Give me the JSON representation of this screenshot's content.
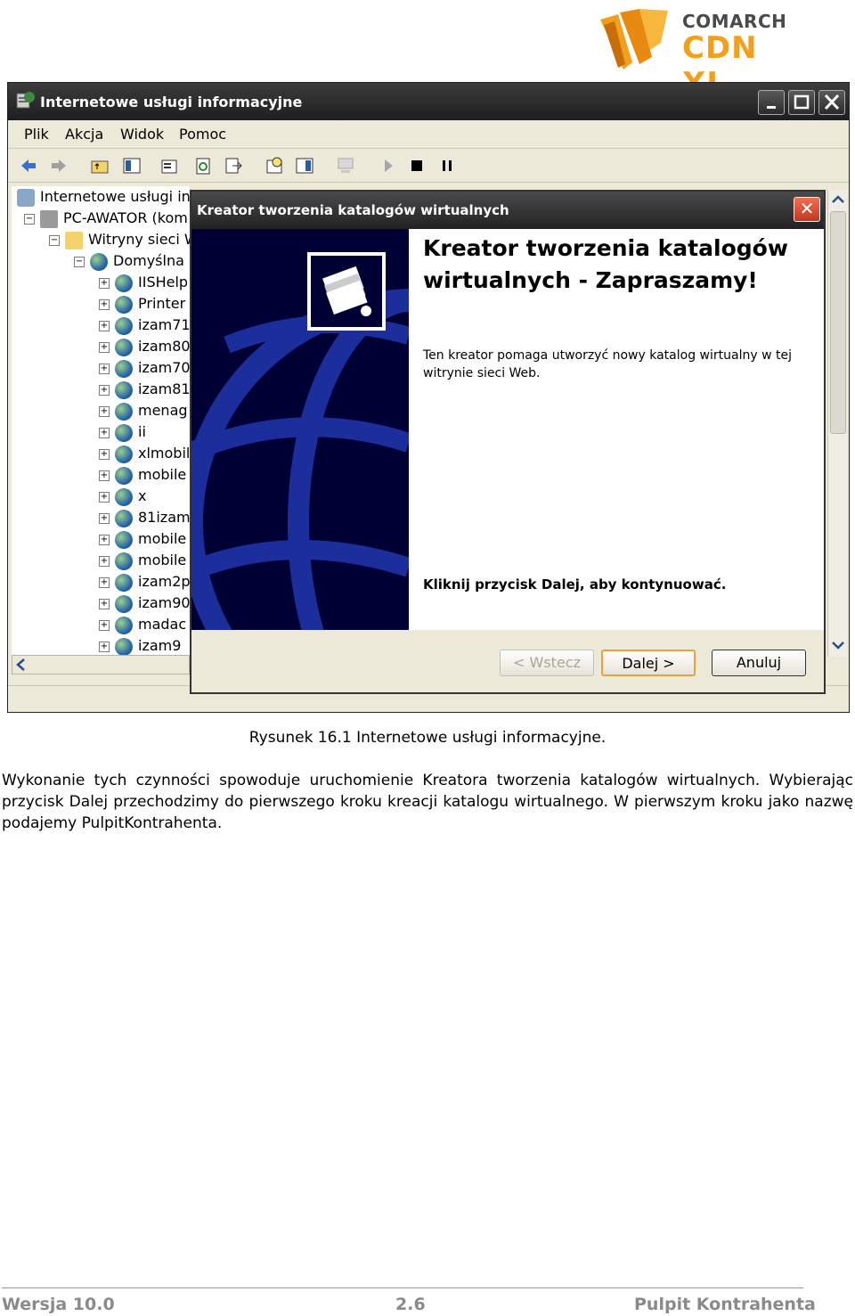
{
  "logo": {
    "line1": "COMARCH",
    "line2": "CDN XL"
  },
  "window": {
    "title": "Internetowe usługi informacyjne",
    "controls": [
      "minimize-icon",
      "maximize-icon",
      "close-icon"
    ],
    "menu": [
      "Plik",
      "Akcja",
      "Widok",
      "Pomoc"
    ],
    "toolbar_icons": [
      "back-arrow-icon",
      "forward-arrow-icon",
      "up-folder-icon",
      "show-tree-icon",
      "properties-icon",
      "refresh-icon",
      "export-icon",
      "help-icon",
      "console-icon",
      "computer-icon",
      "play-icon",
      "stop-icon",
      "pause-icon"
    ]
  },
  "tree": {
    "root": "Internetowe usługi inf",
    "computer": "PC-AWATOR (kom",
    "sites_folder": "Witryny sieci W",
    "default_site": "Domyślna",
    "children": [
      "IISHelp",
      "Printer",
      "izam71",
      "izam80",
      "izam70",
      "izam81",
      "menag",
      "ii",
      "xlmobil",
      "mobile",
      "x",
      "81izam",
      "mobile",
      "mobile",
      "izam2p",
      "izam90",
      "madac",
      "izam9"
    ]
  },
  "wizard": {
    "title": "Kreator tworzenia katalogów wirtualnych",
    "heading": "Kreator tworzenia katalogów wirtualnych - Zapraszamy!",
    "description": "Ten kreator pomaga utworzyć nowy katalog wirtualny w tej witrynie sieci Web.",
    "continue_hint": "Kliknij przycisk Dalej, aby kontynuować.",
    "buttons": {
      "back": "< Wstecz",
      "next": "Dalej >",
      "cancel": "Anuluj"
    }
  },
  "caption": "Rysunek 16.1 Internetowe usługi informacyjne.",
  "paragraph": "Wykonanie tych czynności spowoduje uruchomienie Kreatora tworzenia katalogów wirtualnych. Wybierając przycisk Dalej przechodzimy do pierwszego kroku kreacji katalogu wirtualnego. W pierwszym kroku jako nazwę podajemy PulpitKontrahenta.",
  "footer": {
    "version": "Wersja 10.0",
    "section": "2.6",
    "chapter": "Pulpit Kontrahenta"
  },
  "colors": {
    "logo_orange": "#f2a01c",
    "dialog_blue_panel": "#000034",
    "footer_gray": "#8a8a8a"
  }
}
